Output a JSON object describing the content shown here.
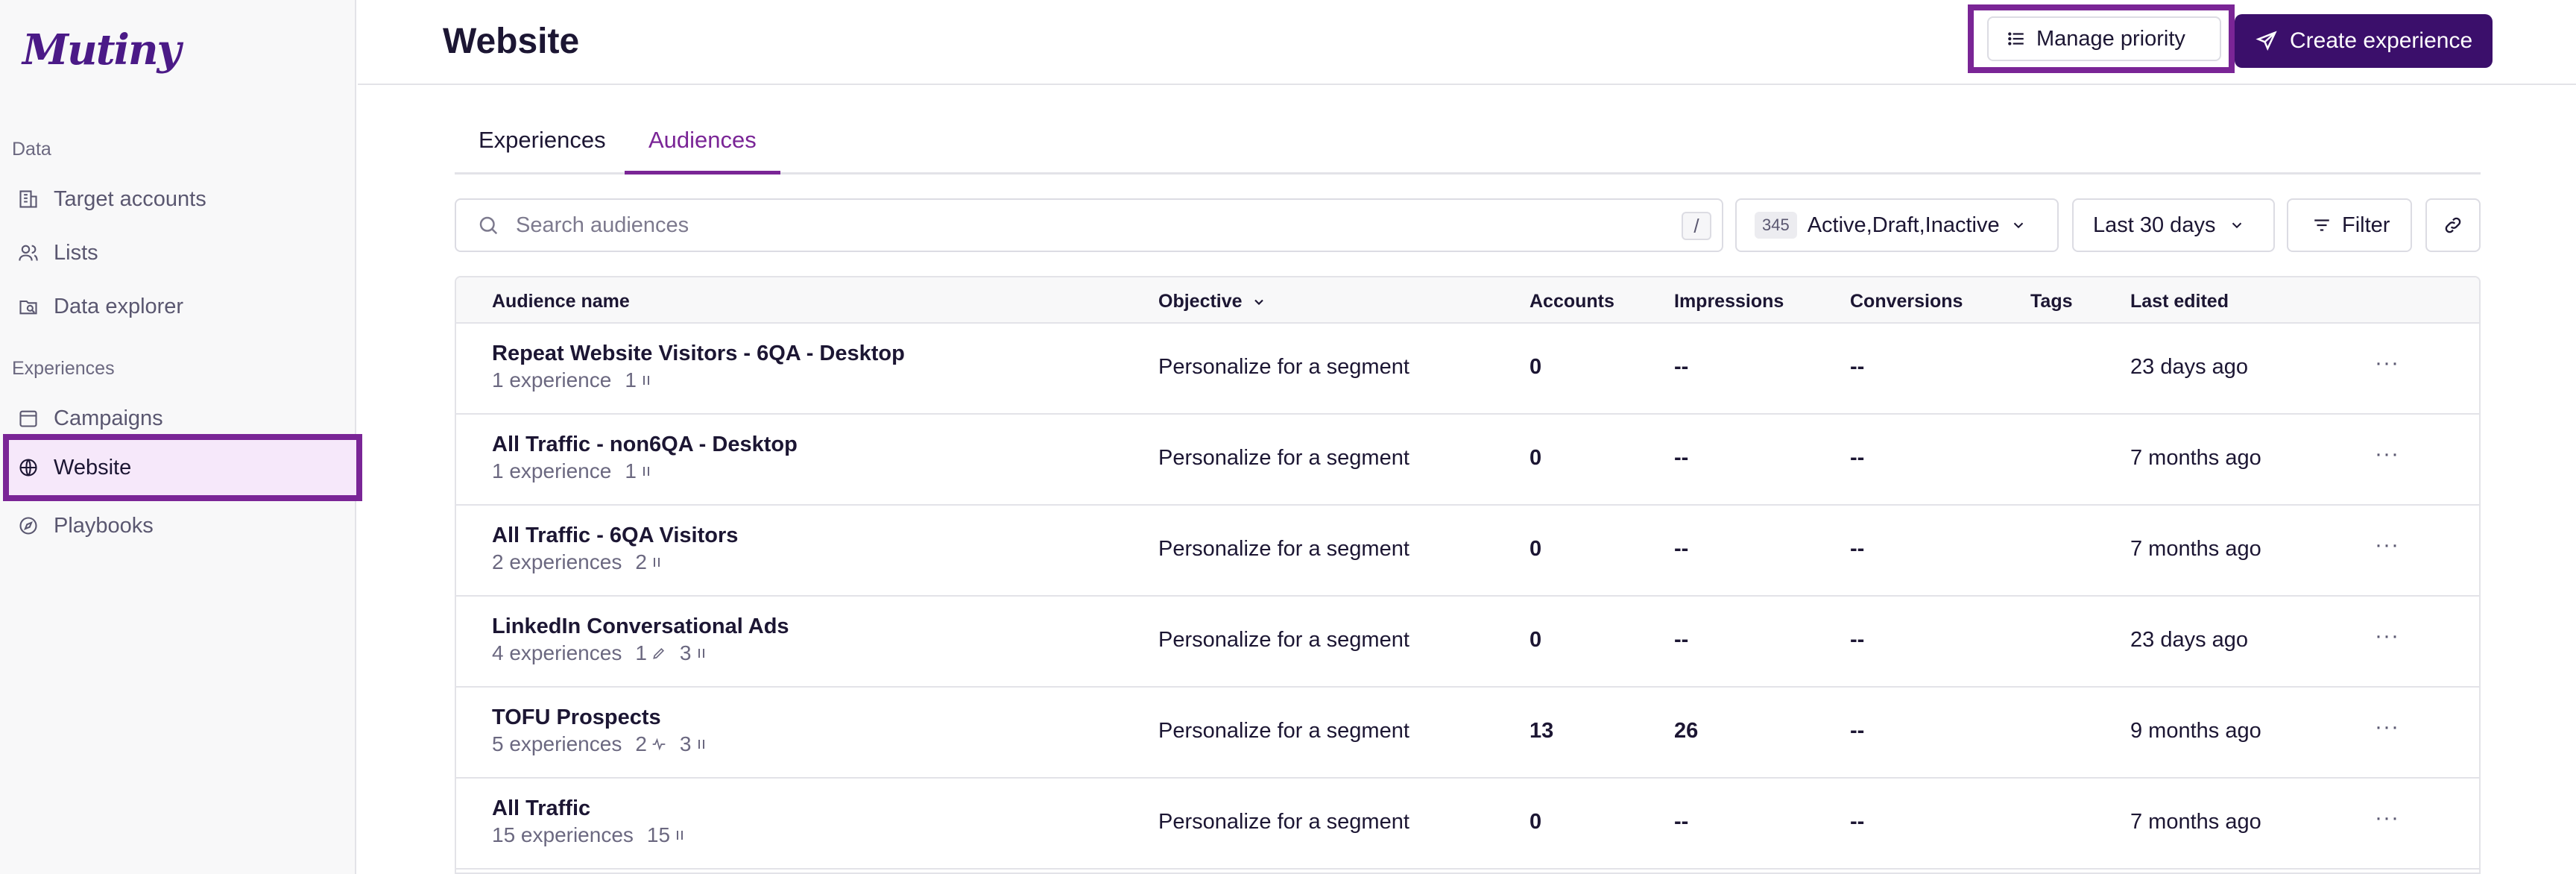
{
  "app": {
    "logo_text": "Mutiny"
  },
  "sidebar": {
    "sections": [
      {
        "label": "Data",
        "items": [
          {
            "label": "Target accounts",
            "icon": "building-icon"
          },
          {
            "label": "Lists",
            "icon": "users-icon"
          },
          {
            "label": "Data explorer",
            "icon": "folder-search-icon"
          }
        ]
      },
      {
        "label": "Experiences",
        "items": [
          {
            "label": "Campaigns",
            "icon": "calendar-icon"
          },
          {
            "label": "Website",
            "icon": "globe-icon",
            "active": true
          },
          {
            "label": "Playbooks",
            "icon": "compass-icon"
          }
        ]
      }
    ]
  },
  "header": {
    "title": "Website",
    "manage_priority_label": "Manage priority",
    "create_experience_label": "Create experience"
  },
  "tabs": [
    {
      "label": "Experiences",
      "active": false
    },
    {
      "label": "Audiences",
      "active": true
    }
  ],
  "toolbar": {
    "search_placeholder": "Search audiences",
    "search_shortcut": "/",
    "status_count": "345",
    "status_value": "Active,Draft,Inactive",
    "date_range": "Last 30 days",
    "filter_label": "Filter"
  },
  "table": {
    "columns": [
      "Audience name",
      "Objective",
      "Accounts",
      "Impressions",
      "Conversions",
      "Tags",
      "Last edited"
    ],
    "rows": [
      {
        "name": "Repeat Website Visitors - 6QA - Desktop",
        "experiences": "1 experience",
        "stats": [
          {
            "value": "1",
            "icon": "pause-icon"
          }
        ],
        "objective": "Personalize for a segment",
        "accounts": "0",
        "impressions": "--",
        "conversions": "--",
        "tags": "",
        "last_edited": "23 days ago"
      },
      {
        "name": "All Traffic - non6QA - Desktop",
        "experiences": "1 experience",
        "stats": [
          {
            "value": "1",
            "icon": "pause-icon"
          }
        ],
        "objective": "Personalize for a segment",
        "accounts": "0",
        "impressions": "--",
        "conversions": "--",
        "tags": "",
        "last_edited": "7 months ago"
      },
      {
        "name": "All Traffic - 6QA Visitors",
        "experiences": "2 experiences",
        "stats": [
          {
            "value": "2",
            "icon": "pause-icon"
          }
        ],
        "objective": "Personalize for a segment",
        "accounts": "0",
        "impressions": "--",
        "conversions": "--",
        "tags": "",
        "last_edited": "7 months ago"
      },
      {
        "name": "LinkedIn Conversational Ads",
        "experiences": "4 experiences",
        "stats": [
          {
            "value": "1",
            "icon": "pencil-icon"
          },
          {
            "value": "3",
            "icon": "pause-icon"
          }
        ],
        "objective": "Personalize for a segment",
        "accounts": "0",
        "impressions": "--",
        "conversions": "--",
        "tags": "",
        "last_edited": "23 days ago"
      },
      {
        "name": "TOFU Prospects",
        "experiences": "5 experiences",
        "stats": [
          {
            "value": "2",
            "icon": "activity-icon"
          },
          {
            "value": "3",
            "icon": "pause-icon"
          }
        ],
        "objective": "Personalize for a segment",
        "accounts": "13",
        "impressions": "26",
        "conversions": "--",
        "tags": "",
        "last_edited": "9 months ago"
      },
      {
        "name": "All Traffic",
        "experiences": "15 experiences",
        "stats": [
          {
            "value": "15",
            "icon": "pause-icon"
          }
        ],
        "objective": "Personalize for a segment",
        "accounts": "0",
        "impressions": "--",
        "conversions": "--",
        "tags": "",
        "last_edited": "7 months ago"
      }
    ],
    "row_menu": "···"
  },
  "colors": {
    "brand": "#3b0f6b",
    "accent": "#7a2596",
    "highlight": "#f6e8fa"
  }
}
